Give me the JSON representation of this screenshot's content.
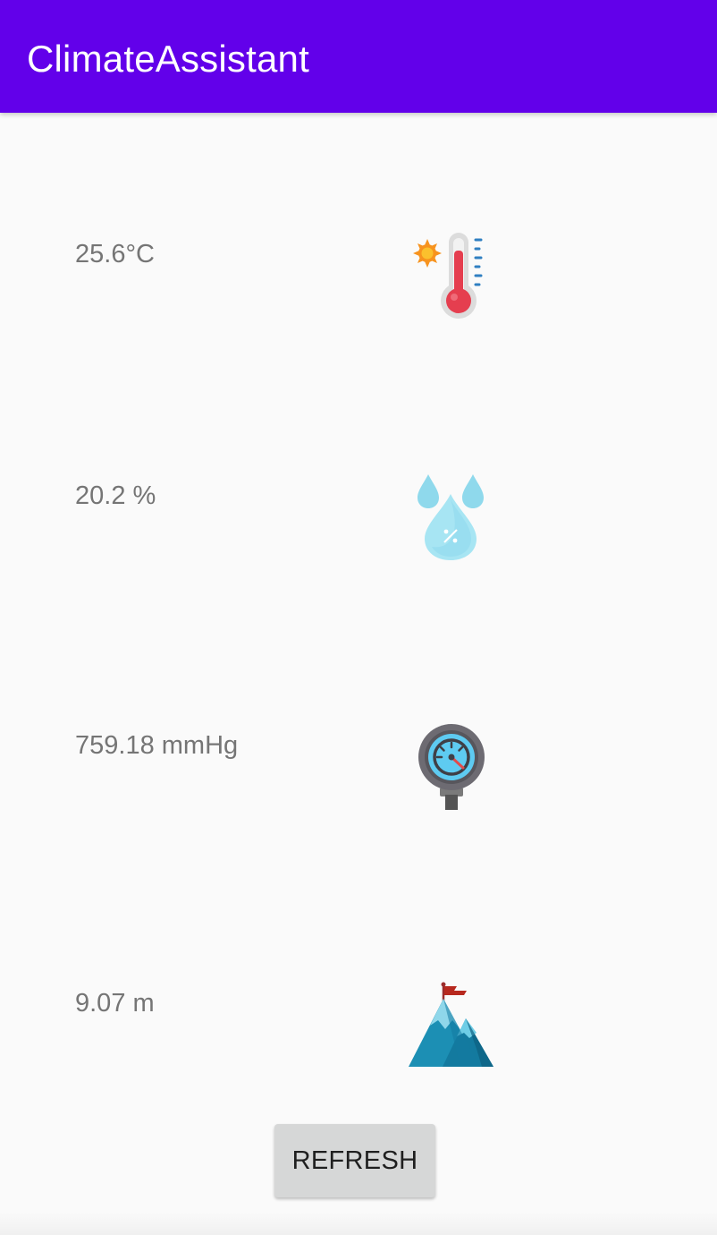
{
  "app": {
    "title": "ClimateAssistant",
    "primary_color": "#6200ea"
  },
  "readings": [
    {
      "id": "temperature",
      "value": "25.6°C",
      "icon": "thermometer-sun-icon"
    },
    {
      "id": "humidity",
      "value": "20.2 %",
      "icon": "water-drops-percent-icon"
    },
    {
      "id": "pressure",
      "value": "759.18 mmHg",
      "icon": "pressure-gauge-icon"
    },
    {
      "id": "altitude",
      "value": "9.07 m",
      "icon": "mountain-flag-icon"
    }
  ],
  "actions": {
    "refresh_label": "REFRESH"
  }
}
